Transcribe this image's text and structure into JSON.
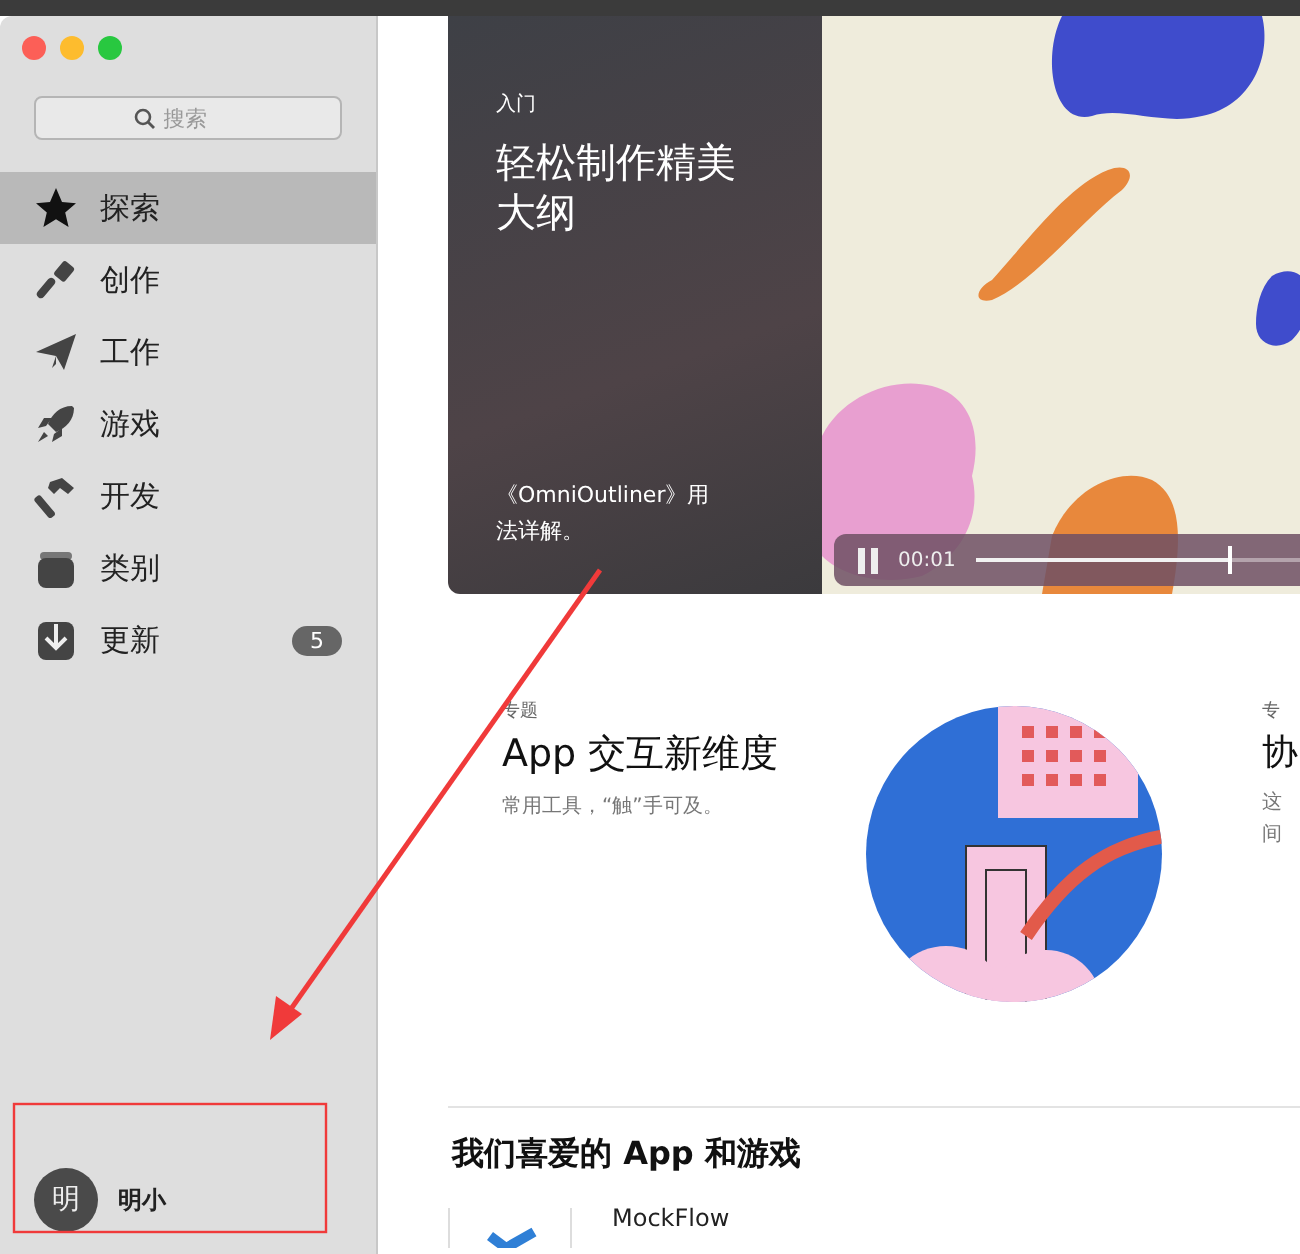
{
  "sidebar": {
    "search": {
      "placeholder": "搜索"
    },
    "items": [
      {
        "label": "探索",
        "selected": true
      },
      {
        "label": "创作",
        "selected": false
      },
      {
        "label": "工作",
        "selected": false
      },
      {
        "label": "游戏",
        "selected": false
      },
      {
        "label": "开发",
        "selected": false
      },
      {
        "label": "类别",
        "selected": false
      },
      {
        "label": "更新",
        "selected": false,
        "badge": "5"
      }
    ],
    "user": {
      "avatar": "明",
      "name": "明小"
    }
  },
  "hero": {
    "eyebrow": "入门",
    "title": "轻松制作精美大纲",
    "description": "《OmniOutliner》用法详解。",
    "video": {
      "playing": true,
      "time": "00:01",
      "level": 0.62
    }
  },
  "features": [
    {
      "eyebrow": "专题",
      "title": "App 交互新维度",
      "subtitle_lines": [
        "常用工具，“触”手可及。"
      ]
    },
    {
      "eyebrow": "专",
      "title": "协",
      "subtitle_lines": [
        "这",
        "间"
      ]
    }
  ],
  "section": {
    "title": "我们喜爱的 App 和游戏",
    "apps": [
      {
        "name": "MockFlow"
      }
    ]
  }
}
